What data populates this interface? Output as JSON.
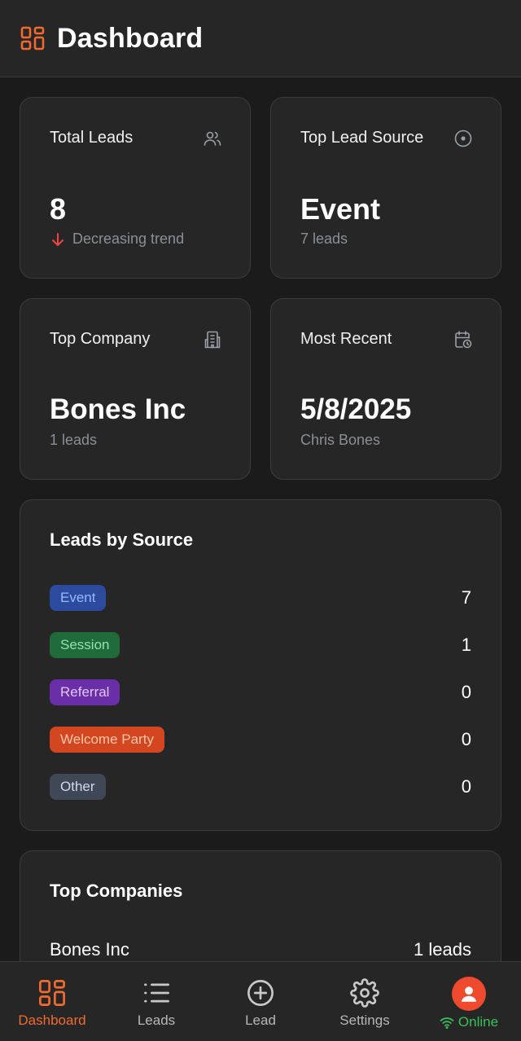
{
  "header": {
    "title": "Dashboard",
    "accent_color": "#f26b2e",
    "icon": "dashboard-grid-icon"
  },
  "stats": {
    "total_leads": {
      "title": "Total Leads",
      "value": "8",
      "subtitle": "Decreasing trend",
      "icon": "users-icon",
      "trend_icon": "arrow-down-icon",
      "trend_color": "#ef4444"
    },
    "top_lead_source": {
      "title": "Top Lead Source",
      "value": "Event",
      "subtitle": "7 leads",
      "icon": "target-icon"
    },
    "top_company": {
      "title": "Top Company",
      "value": "Bones Inc",
      "subtitle": "1 leads",
      "icon": "building-icon"
    },
    "most_recent": {
      "title": "Most Recent",
      "value": "5/8/2025",
      "subtitle": "Chris Bones",
      "icon": "calendar-clock-icon"
    }
  },
  "leads_by_source": {
    "title": "Leads by Source",
    "items": [
      {
        "label": "Event",
        "count": "7",
        "bg": "#2c4b9e",
        "fg": "#9cb8ff"
      },
      {
        "label": "Session",
        "count": "1",
        "bg": "#1f6b3c",
        "fg": "#8fe3a8"
      },
      {
        "label": "Referral",
        "count": "0",
        "bg": "#6a2ea8",
        "fg": "#e3c7ff"
      },
      {
        "label": "Welcome Party",
        "count": "0",
        "bg": "#d4461f",
        "fg": "#ffc7a8"
      },
      {
        "label": "Other",
        "count": "0",
        "bg": "#3f4856",
        "fg": "#d3dae5"
      }
    ]
  },
  "top_companies": {
    "title": "Top Companies",
    "items": [
      {
        "name": "Bones Inc",
        "count": "1 leads"
      }
    ]
  },
  "nav": {
    "items": [
      {
        "label": "Dashboard",
        "icon": "dashboard-grid-icon",
        "active": true
      },
      {
        "label": "Leads",
        "icon": "list-icon",
        "active": false
      },
      {
        "label": "Lead",
        "icon": "plus-circle-icon",
        "active": false
      },
      {
        "label": "Settings",
        "icon": "gear-icon",
        "active": false
      }
    ],
    "status": {
      "label": "Online",
      "color": "#36c15b",
      "icon": "wifi-icon",
      "avatar_icon": "user-avatar-icon"
    }
  }
}
